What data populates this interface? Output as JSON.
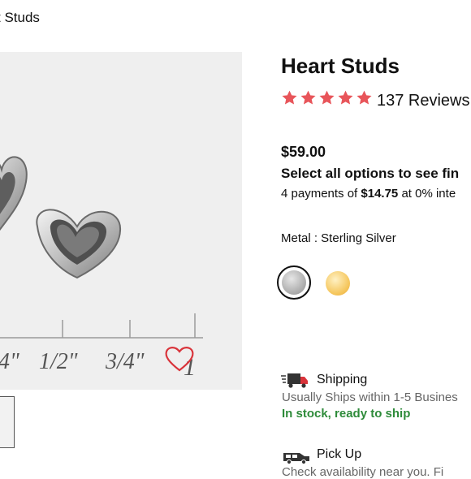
{
  "breadcrumb": {
    "current": "t Studs"
  },
  "product": {
    "title": "Heart Studs",
    "rating_stars": 5,
    "reviews": "137 Reviews",
    "price": "$59.00",
    "select_note": "Select all options to see fin",
    "payments": {
      "prefix": "4 payments of ",
      "amount": "$14.75",
      "suffix": " at 0% inte"
    },
    "metal_label": "Metal : Sterling Silver",
    "swatches": [
      {
        "name": "Sterling Silver",
        "selected": true
      },
      {
        "name": "Gold",
        "selected": false
      }
    ]
  },
  "image": {
    "ruler_labels": [
      "4\"",
      "1/2\"",
      "3/4\"",
      "1"
    ]
  },
  "delivery": {
    "shipping_title": "Shipping",
    "shipping_note": "Usually Ships within 1-5 Busines",
    "stock": "In stock, ready to ship",
    "pickup_title": "Pick Up",
    "pickup_sub": "Check availability near you. Fi"
  },
  "colors": {
    "star": "#e8555a",
    "stock": "#2e8b3a",
    "heart_icon": "#d9343b"
  }
}
